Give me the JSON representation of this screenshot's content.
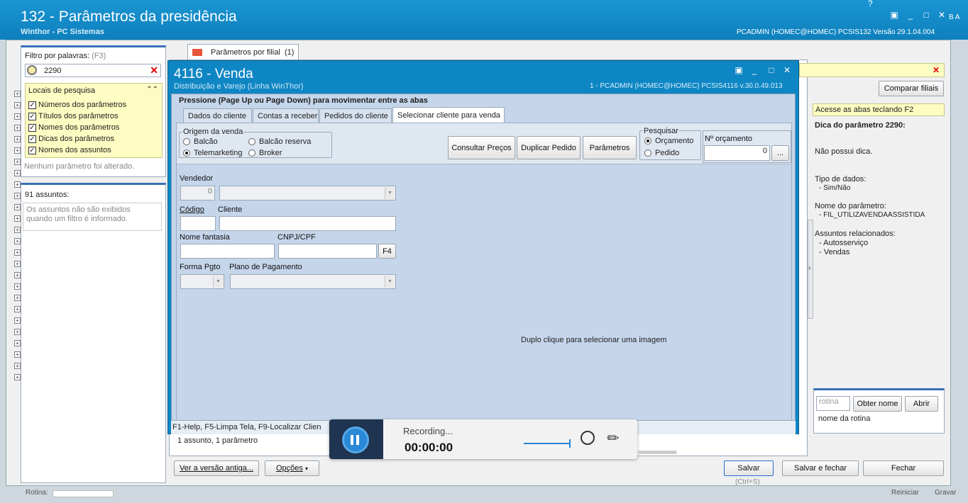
{
  "main_window": {
    "title": "132 - Parâmetros da presidência",
    "subtitle": "Winthor - PC Sistemas",
    "status": "PCADMIN (HOMEC@HOMEC)   PCSIS132  Versão  29.1.04.004",
    "help_glyph": "?",
    "cut_right_text": "B A"
  },
  "left_panel": {
    "filter_label": "Filtro por palavras:",
    "filter_shortcut": "(F3)",
    "search_value": "2290",
    "locais_title": "Locais de pesquisa",
    "locais": [
      "Números dos parâmetros",
      "Títulos dos parâmetros",
      "Nomes dos parâmetros",
      "Dicas dos parâmetros",
      "Nomes dos assuntos"
    ],
    "no_change_text": "Nenhum parâmetro foi alterado.",
    "assuntos_count": "91 assuntos:",
    "assuntos_info": "Os assuntos não são exibidos quando um filtro é informado."
  },
  "center": {
    "tab_label": "Parâmetros por filial",
    "tab_count": "(1)",
    "close_x": "✕",
    "status_text": "1 assunto, 1 parâmetro",
    "btn_old_version": "Ver a versão antiga...",
    "btn_options": "Opções"
  },
  "right_panel": {
    "compare_button": "Comparar filiais",
    "hint_bar": "Acesse as abas teclando F2",
    "hint_title": "Dica do parâmetro 2290:",
    "hint_text": "Não possui dica.",
    "tipo_label": "Tipo de dados:",
    "tipo_value": "- Sim/Não",
    "nome_label": "Nome do parâmetro:",
    "nome_value": "- FIL_UTILIZAVENDAASSISTIDA",
    "assuntos_label": "Assuntos relacionados:",
    "assuntos": [
      "- Autosserviço",
      "- Vendas"
    ],
    "rotina_placeholder": "rotina",
    "obter_nome_button": "Obter nome",
    "abrir_button": "Abrir",
    "nome_rotina": "nome da rotina"
  },
  "bottom": {
    "salvar": "Salvar",
    "salvar_shortcut": "(Ctrl+S)",
    "salvar_fechar": "Salvar e fechar",
    "fechar": "Fechar",
    "cut_left": "Rotina:",
    "cut_reiniciar": "Reiniciar",
    "cut_gravar": "Gravar"
  },
  "venda_window": {
    "title": "4116 - Venda",
    "subtitle": "Distribuição e Varejo (Linha WinThor)",
    "status": "1 - PCADMIN (HOMEC@HOMEC)   PCSIS4116  v.30.0.49.013",
    "tabs_hint": "Pressione (Page Up ou Page Down) para movimentar entre as abas",
    "tabs": [
      "Dados do cliente",
      "Contas a receber",
      "Pedidos do cliente",
      "Selecionar cliente para venda"
    ],
    "active_tab": 3,
    "origem_title": "Origem da venda",
    "origem_options": [
      "Balcão",
      "Balcão reserva",
      "Telemarketing",
      "Broker"
    ],
    "origem_selected": "Telemarketing",
    "btn_consultar": "Consultar Preços",
    "btn_duplicar": "Duplicar Pedido",
    "btn_parametros": "Parâmetros",
    "pesquisar_title": "Pesquisar",
    "pesquisar_options": [
      "Orçamento",
      "Pedido"
    ],
    "pesquisar_selected": "Orçamento",
    "orcamento_label": "Nº orçamento",
    "orcamento_value": "0",
    "orcamento_btn": "...",
    "vendedor_label": "Vendedor",
    "vendedor_value": "0",
    "codigo_label": "Código",
    "cliente_label": "Cliente",
    "fantasia_label": "Nome fantasia",
    "cnpj_label": "CNPJ/CPF",
    "f4_button": "F4",
    "formapgto_label": "Forma Pgto",
    "plano_label": "Plano de Pagamento",
    "image_hint": "Duplo clique para selecionar uma imagem",
    "footer_text": "F1-Help, F5-Limpa Tela, F9-Localizar Clien"
  },
  "recording": {
    "label": "Recording...",
    "time": "00:00:00"
  },
  "colors": {
    "title_bar": "#0e86c4",
    "venda_bg": "#c5d5ea",
    "hint_yellow": "#fdfcc2",
    "recorder_bg": "#f2f2f2"
  }
}
